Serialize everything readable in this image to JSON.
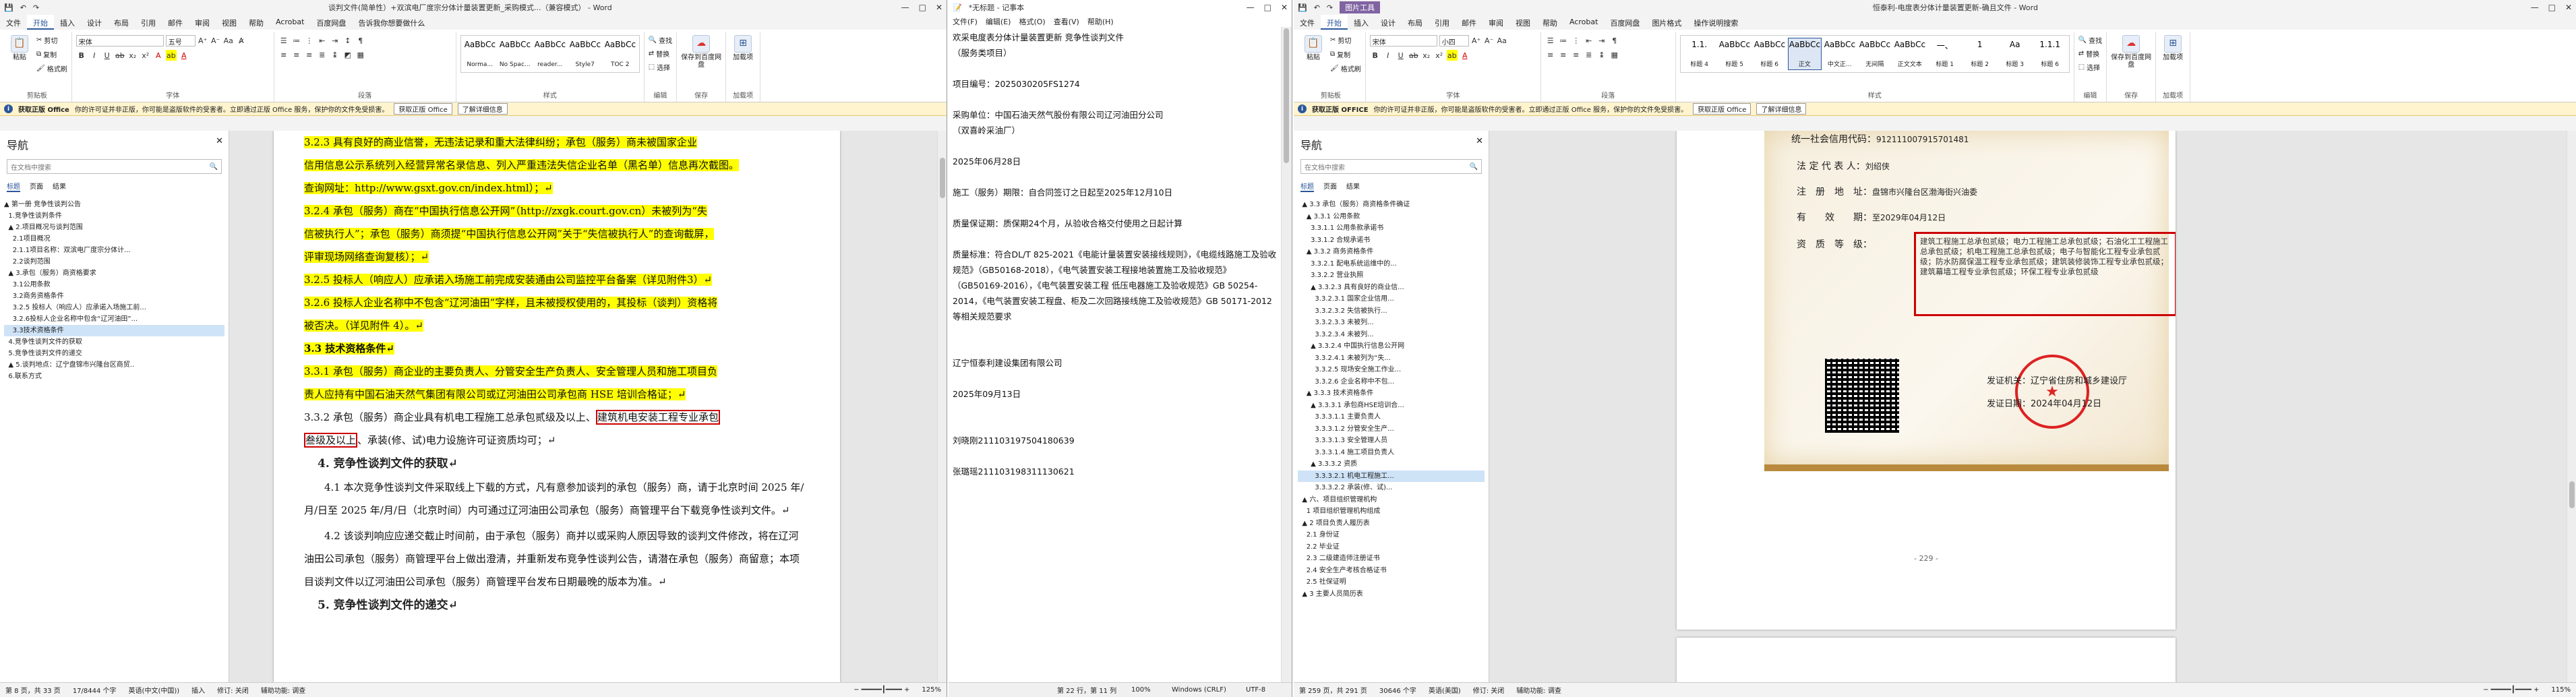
{
  "win1": {
    "title": "谈判文件(简单性）+双滨电厂度宗分体计量装置更新_采购模式...（兼容模式） - Word",
    "controls": [
      "—",
      "□",
      "✕"
    ],
    "tabs": [
      "文件",
      "开始",
      "插入",
      "设计",
      "布局",
      "引用",
      "邮件",
      "审阅",
      "视图",
      "帮助",
      "Acrobat",
      "百度网盘",
      "告诉我你想要做什么"
    ],
    "active_tab": "开始",
    "ribbon": {
      "clipboard": {
        "label": "剪贴板",
        "paste": "粘贴",
        "items": [
          "剪切",
          "复制",
          "格式刷"
        ]
      },
      "font": {
        "label": "字体",
        "font_name": "宋体",
        "font_size": "五号"
      },
      "paragraph": {
        "label": "段落"
      },
      "styles": {
        "label": "样式",
        "items": [
          {
            "preview": "AaBbCcDd",
            "name": "Norma..."
          },
          {
            "preview": "AaBbCcDd",
            "name": "No Spac..."
          },
          {
            "preview": "AaBbCcDd",
            "name": "reader..."
          },
          {
            "preview": "AaBbCcDd",
            "name": "Style7"
          },
          {
            "preview": "AaBbCcD",
            "name": "TOC 2"
          }
        ]
      },
      "editing": {
        "label": "编辑",
        "items": [
          "查找",
          "替换",
          "选择"
        ]
      },
      "save": {
        "label": "保存到百度网盘",
        "sub": "保存"
      },
      "addins": {
        "label": "加载项",
        "sub": "加载项"
      }
    },
    "infobar": {
      "title": "获取正版 Office",
      "text": "你的许可证并非正版，你可能是盗版软件的受害者。立即通过正版 Office 服务，保护你的文件免受损害。",
      "btn1": "获取正版 Office",
      "btn2": "了解详细信息"
    },
    "nav": {
      "title": "导航",
      "search_placeholder": "在文档中搜索",
      "tabs": [
        "标题",
        "页面",
        "结果"
      ],
      "tree": [
        "▲ 第一册 竞争性谈判公告",
        "  1.竞争性谈判条件",
        "  ▲ 2.项目概况与谈判范围",
        "    2.1项目概况",
        "    2.1.1项目名称：双滨电厂度宗分体计...",
        "    2.2谈判范围",
        "  ▲ 3.承包（服务）商资格要求",
        "    3.1公用条款",
        "    3.2商务资格条件",
        "    3.2.5 投标人（响应人）应承诺入场施工前...",
        "    3.2.6投标人企业名称中包含“辽河油田”...",
        "    3.3技术资格条件",
        "  4.竞争性谈判文件的获取",
        "  5.竞争性谈判文件的递交",
        "  ▲ 5.谈判地点：辽宁盘锦市兴隆台区商贸..",
        "  6.联系方式"
      ],
      "selected_index": 11
    },
    "page": {
      "lines": [
        {
          "hl": true,
          "text": "3.2.3 具有良好的商业信誉，无违法记录和重大法律纠纷；承包（服务）商未被国家企业"
        },
        {
          "hl": true,
          "text": "信用信息公示系统列入经营异常名录信息、列入严重违法失信企业名单（黑名单）信息再次截图。"
        },
        {
          "hl": true,
          "text": "查询网址：http://www.gsxt.gov.cn/index.html）；↵"
        },
        {
          "hl": true,
          "text": "3.2.4 承包（服务）商在“中国执行信息公开网”（http://zxgk.court.gov.cn）未被列为“失"
        },
        {
          "hl": true,
          "text": "信被执行人”；承包（服务）商须提“中国执行信息公开网”关于“失信被执行人”的查询截屏，"
        },
        {
          "hl": true,
          "text": "评审现场网络查询复核）；↵"
        },
        {
          "hl": true,
          "text": "3.2.5 投标人（响应人）应承诺入场施工前完成安装通由公司监控平台备案（详见附件3）↵"
        },
        {
          "hl": true,
          "text": "3.2.6 投标人企业名称中不包含“辽河油田”字样，且未被授权使用的，其投标（谈判）资格将"
        },
        {
          "hl": true,
          "text": "被否决。（详见附件 4）。↵"
        }
      ],
      "heading33": "3.3 技术资格条件↵",
      "lines2": [
        {
          "hl": true,
          "text": "3.3.1 承包（服务）商企业的主要负责人、分管安全生产负责人、安全管理人员和施工项目负"
        },
        {
          "hl": true,
          "text": "责人应持有中国石油天然气集团有限公司或辽河油田公司承包商 HSE 培训合格证；↵"
        }
      ],
      "line332a": "3.3.2 承包（服务）商企业具有机电工程施工总承包贰级及以上、",
      "line332box": "建筑机电安装工程专业承包",
      "line332b_box": "叁级及以上",
      "line332c": "、承装(修、试)电力设施许可证资质均可；↵",
      "heading4": "4. 竞争性谈判文件的获取↵",
      "p41": "4.1 本次竞争性谈判文件采取线上下载的方式，凡有意参加谈判的承包（服务）商，请于北京时间 2025 年/月/日至 2025 年/月/日（北京时间）内可通过辽河油田公司承包（服务）商管理平台下载竞争性谈判文件。↵",
      "p42": "4.2 该谈判响应应递交截止时间前，由于承包（服务）商并以或采购人原因导致的谈判文件修改，将在辽河油田公司承包（服务）商管理平台上做出澄清，并重新发布竞争性谈判公告，请潜在承包（服务）商留意；本项目谈判文件以辽河油田公司承包（服务）商管理平台发布日期最晚的版本为准。↵",
      "heading5": "5. 竞争性谈判文件的递交↵"
    },
    "status": {
      "page": "第 8 页，共 33 页",
      "words": "17/8444 个字",
      "lang": "英语(中文(中国))",
      "insert": "插入",
      "track": "修订: 关闭",
      "accessibility": "辅助功能: 调查",
      "zoom": "125%"
    }
  },
  "win2": {
    "title": "*无标题 - 记事本",
    "menu": [
      "文件(F)",
      "编辑(E)",
      "格式(O)",
      "查看(V)",
      "帮助(H)"
    ],
    "text": "欢采电度表分体计量装置更新 竞争性谈判文件\n（服务类项目）\n\n项目编号：2025030205FS1274\n\n采购单位：中国石油天然气股份有限公司辽河油田分公司\n（双喜岭采油厂）\n\n2025年06月28日\n\n施工（服务）期限：自合同签订之日起至2025年12月10日\n\n质量保证期：质保期24个月，从验收合格交付使用之日起计算\n\n质量标准：符合DL/T 825-2021《电能计量装置安装接线规则》，《电缆线路施工及验收规范》（GB50168-2018），《电气装置安装工程接地装置施工及验收规范》（GB50169-2016），《电气装置安装工程 低压电器施工及验收规范》GB 50254-2014，《电气装置安装工程盘、柜及二次回路接线施工及验收规范》GB 50171-2012等相关规范要求\n\n\n辽宁恒泰利建设集团有限公司\n\n2025年09月13日\n\n\n刘晓刚211103197504180639\n\n张璐瑶211103198311130621",
    "status": {
      "pos": "第 22 行，第 11 列",
      "zoom": "100%",
      "eol": "Windows (CRLF)",
      "enc": "UTF-8"
    }
  },
  "win3": {
    "title": "恒泰利-电度表分体计量装置更新-确且文件 - Word",
    "picture_tools": "图片工具",
    "tabs": [
      "文件",
      "开始",
      "插入",
      "设计",
      "布局",
      "引用",
      "邮件",
      "审阅",
      "视图",
      "帮助",
      "Acrobat",
      "百度网盘",
      "图片格式",
      "操作说明搜索"
    ],
    "active_tab": "开始",
    "ribbon": {
      "clipboard": {
        "label": "剪贴板",
        "paste": "粘贴",
        "items": [
          "剪切",
          "复制",
          "格式刷"
        ]
      },
      "font": {
        "label": "字体",
        "font_name": "宋体",
        "font_size": "小四"
      },
      "paragraph": {
        "label": "段落"
      },
      "styles": {
        "label": "样式",
        "items": [
          {
            "preview": "1.1.",
            "name": "标题 4"
          },
          {
            "preview": "AaBbCc",
            "name": "标题 5"
          },
          {
            "preview": "AaBbCcI",
            "name": "标题 6"
          },
          {
            "preview": "AaBbCcD",
            "name": "正文"
          },
          {
            "preview": "AaBbCcI",
            "name": "中文正..."
          },
          {
            "preview": "AaBbCcD",
            "name": "无间隔"
          },
          {
            "preview": "AaBbCcD",
            "name": "正文文本"
          },
          {
            "preview": "一、",
            "name": "标题 1"
          },
          {
            "preview": "1",
            "name": "标题 2"
          },
          {
            "preview": "Aa",
            "name": "标题 3"
          },
          {
            "preview": "1.1.1",
            "name": "标题 6"
          }
        ],
        "selected_index": 3
      },
      "editing": {
        "label": "编辑",
        "items": [
          "查找",
          "替换",
          "选择"
        ]
      },
      "save": {
        "label": "保存到百度网盘",
        "sub": "保存"
      },
      "addins": {
        "label": "加载项",
        "sub": "加载项"
      }
    },
    "infobar": {
      "title": "获取正版 OFFICE",
      "text": "你的许可证并非正版，你可能是盗版软件的受害者。立即通过正版 Office 服务，保护你的文件免受损害。",
      "btn1": "获取正版 Office",
      "btn2": "了解详细信息"
    },
    "nav": {
      "title": "导航",
      "search_placeholder": "在文档中搜索",
      "tabs": [
        "标题",
        "页面",
        "结果"
      ],
      "tree": [
        "  ▲ 3.3 承包（服务）商资格条件确证",
        "    ▲ 3.3.1 公用条款",
        "      3.3.1.1 公用条款承诺书",
        "      3.3.1.2 合规承诺书",
        "    ▲ 3.3.2 商务资格条件",
        "      3.3.2.1 配电系统运维中的...",
        "      3.3.2.2 营业执照",
        "      ▲ 3.3.2.3 具有良好的商业信...",
        "        3.3.2.3.1 国家企业信用...",
        "        3.3.2.3.2 失信被执行...",
        "        3.3.2.3.3 未被列...",
        "        3.3.2.3.4 未被列...",
        "      ▲ 3.3.2.4 中国执行信息公开网",
        "        3.3.2.4.1 未被列为“失...",
        "        3.3.2.5 现场安全施工作业...",
        "        3.3.2.6 企业名称中不包...",
        "    ▲ 3.3.3 技术资格条件",
        "      ▲ 3.3.3.1 承包商HSE培训合...",
        "        3.3.3.1.1 主要负责人",
        "        3.3.3.1.2 分管安全生产...",
        "        3.3.3.1.3 安全管理人员",
        "        3.3.3.1.4 施工项目负责人",
        "      ▲ 3.3.3.2 资质",
        "        3.3.3.2.1 机电工程施工...",
        "        3.3.3.2.2 承装(修、试)...",
        "  ▲ 六、项目组织管理机构",
        "    1 项目组织管理机构组成",
        "  ▲ 2 项目负责人履历表",
        "    2.1 身份证",
        "    2.2 毕业证",
        "    2.3 二级建造师注册证书",
        "    2.4 安全生产考核合格证书",
        "    2.5 社保证明",
        "  ▲ 3 主要人员简历表"
      ],
      "selected_index": 23
    },
    "cert": {
      "credit_label": "统一社会信用代码：",
      "credit_value": "912111007915701481",
      "rep_label": "法 定 代 表 人：",
      "rep_value": "刘绍侠",
      "addr_label": "注　册　地　址：",
      "addr_value": "盘锦市兴隆台区渤海街兴油委",
      "valid_label": "有　　效　　期：",
      "valid_value": "至2029年04月12日",
      "grade_label": "资　质　等　级：",
      "grade_value": "建筑工程施工总承包贰级；电力工程施工总承包贰级；石油化工工程施工总承包贰级；机电工程施工总承包贰级；电子与智能化工程专业承包贰级；防水防腐保温工程专业承包贰级；建筑装修装饰工程专业承包贰级；建筑幕墙工程专业承包贰级；环保工程专业承包贰级",
      "issuer_label": "发证机关：",
      "issuer_value": "辽宁省住房和城乡建设厅",
      "date_label": "发证日期：",
      "date_value": "2024年04月12日",
      "page_number": "- 229 -"
    },
    "status": {
      "page": "第 259 页，共 291 页",
      "words": "30646 个字",
      "lang": "英语(美国)",
      "track": "修订: 关闭",
      "accessibility": "辅助功能: 调查",
      "zoom": "115%"
    }
  }
}
